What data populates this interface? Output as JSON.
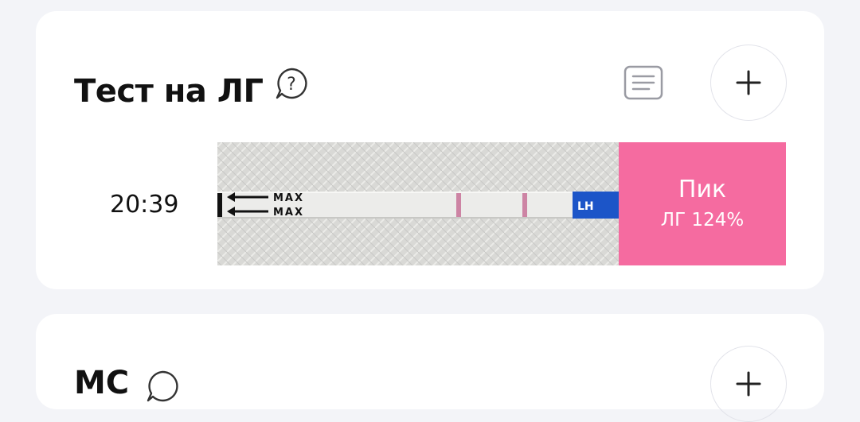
{
  "lh_card": {
    "title": "Тест на ЛГ",
    "help_icon": "question-bubble-icon",
    "list_icon": "list-icon",
    "add_icon": "plus-icon",
    "entry": {
      "time": "20:39",
      "strip_labels": [
        "MAX",
        "MAX",
        "LH"
      ],
      "result_title": "Пик",
      "result_value": "ЛГ 124%",
      "result_color": "#f56ba0"
    }
  },
  "next_card": {
    "title_partial": "МС",
    "help_icon": "question-bubble-icon",
    "add_icon": "plus-icon"
  }
}
